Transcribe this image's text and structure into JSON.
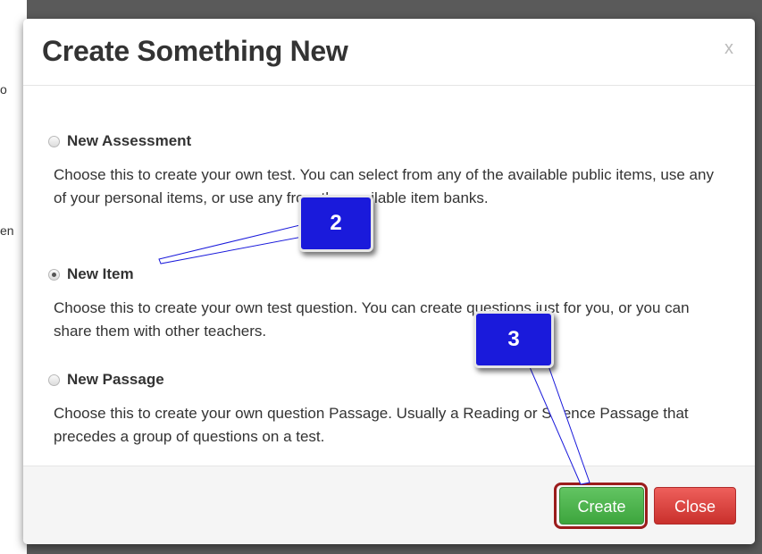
{
  "background": {
    "fragment_top": "o",
    "fragment_mid": "en"
  },
  "modal": {
    "title": "Create Something New",
    "close_glyph": "x",
    "options": [
      {
        "label": "New Assessment",
        "checked": false,
        "description": "Choose this to create your own test. You can select from any of the available public items, use any of your personal items, or use any from the available item banks."
      },
      {
        "label": "New Item",
        "checked": true,
        "description": "Choose this to create your own test question. You can create questions just for you, or you can share them with other teachers."
      },
      {
        "label": "New Passage",
        "checked": false,
        "description": "Choose this to create your own question Passage. Usually a Reading or Science Passage that precedes a group of questions on a test."
      }
    ],
    "footer": {
      "create_label": "Create",
      "close_label": "Close"
    }
  },
  "callouts": {
    "step2": "2",
    "step3": "3"
  },
  "colors": {
    "create": "#4cae4c",
    "close": "#d9534f",
    "callout": "#1a1adb",
    "highlight": "#9b1c1c"
  }
}
